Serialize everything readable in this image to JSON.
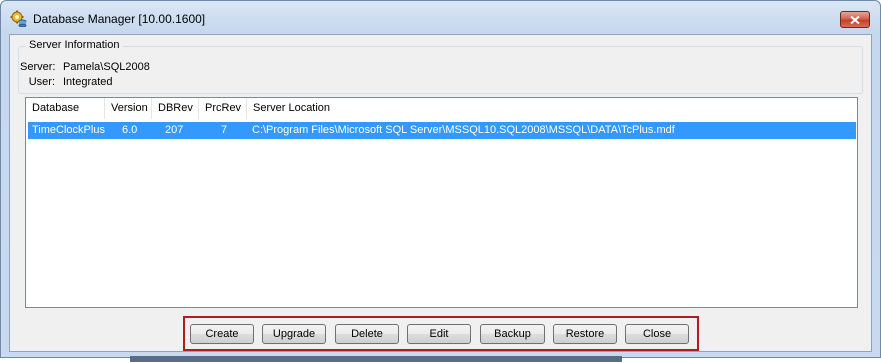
{
  "window": {
    "title": "Database Manager [10.00.1600]"
  },
  "server_info": {
    "group_title": "Server Information",
    "server_label": "Server:",
    "server_value": "Pamela\\SQL2008",
    "user_label": "User:",
    "user_value": "Integrated"
  },
  "table": {
    "columns": [
      "Database",
      "Version",
      "DBRev",
      "PrcRev",
      "Server Location"
    ],
    "rows": [
      {
        "database": "TimeClockPlus",
        "version": "6.0",
        "dbrev": "207",
        "prcrev": "7",
        "location": "C:\\Program Files\\Microsoft SQL Server\\MSSQL10.SQL2008\\MSSQL\\DATA\\TcPlus.mdf",
        "selected": true
      }
    ]
  },
  "buttons": {
    "create": "Create",
    "upgrade": "Upgrade",
    "delete": "Delete",
    "edit": "Edit",
    "backup": "Backup",
    "restore": "Restore",
    "close": "Close"
  },
  "icons": {
    "app": "gear-database-icon",
    "close": "close-icon"
  },
  "colors": {
    "selection": "#3399ff",
    "highlight_border": "#b21c1c",
    "close_button": "#c2402a"
  }
}
